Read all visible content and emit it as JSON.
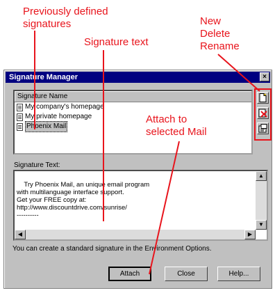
{
  "callouts": {
    "previously_defined": [
      "Previously defined",
      "signatures"
    ],
    "signature_text": "Signature text",
    "new_delete_rename": [
      "New",
      "Delete",
      "Rename"
    ],
    "attach": [
      "Attach to",
      "selected Mail"
    ]
  },
  "colors": {
    "callout": "#e8141c",
    "titlebar": "#000080",
    "face": "#c0c0c0"
  },
  "dialog": {
    "title": "Signature Manager",
    "close_label": "×",
    "list": {
      "header": "Signature Name",
      "items": [
        {
          "label": "My company's homepage",
          "selected": false
        },
        {
          "label": "My private homepage",
          "selected": false
        },
        {
          "label": "Phoenix Mail",
          "selected": true
        }
      ]
    },
    "side_buttons": [
      {
        "name": "new",
        "icon": "new-document-icon"
      },
      {
        "name": "delete",
        "icon": "delete-icon"
      },
      {
        "name": "rename",
        "icon": "rename-icon"
      }
    ],
    "signature_text_label": "Signature Text:",
    "signature_text": "Try Phoenix Mail, an unique email program\nwith multilanguage interface support.\nGet your FREE copy at:\nhttp://www.discountdrive.com/sunrise/\n----------",
    "info": "You can create a standard signature in the Environment Options.",
    "buttons": {
      "attach": "Attach",
      "close": "Close",
      "help": "Help..."
    }
  }
}
